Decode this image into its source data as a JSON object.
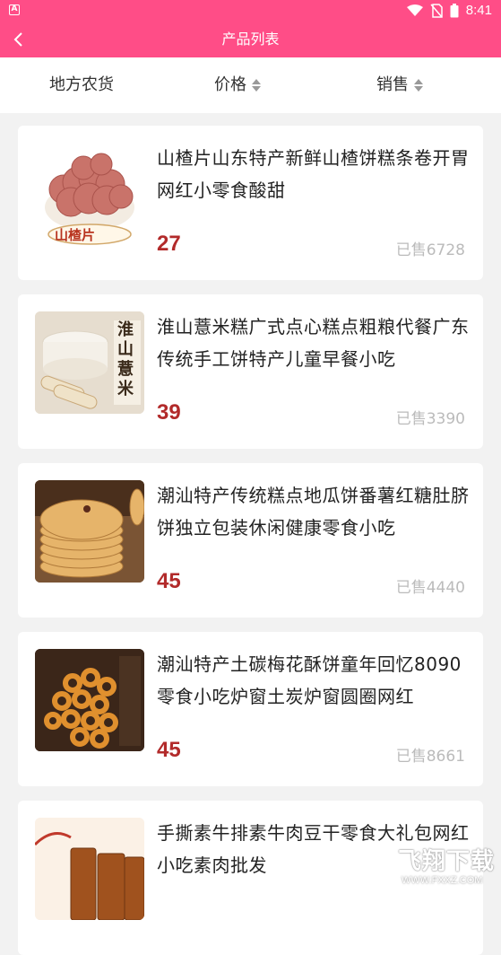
{
  "status_bar": {
    "time": "8:41"
  },
  "app_bar": {
    "title": "产品列表"
  },
  "filters": [
    {
      "label": "地方农货"
    },
    {
      "label": "价格"
    },
    {
      "label": "销售"
    }
  ],
  "products": [
    {
      "name": "山楂片山东特产新鲜山楂饼糕条卷开胃网红小零食酸甜",
      "price": "27",
      "sold": "已售6728",
      "thumb_label": "山楂片"
    },
    {
      "name": "淮山薏米糕广式点心糕点粗粮代餐广东传统手工饼特产儿童早餐小吃",
      "price": "39",
      "sold": "已售3390",
      "thumb_label": "淮山薏米"
    },
    {
      "name": "潮汕特产传统糕点地瓜饼番薯红糖肚脐饼独立包装休闲健康零食小吃",
      "price": "45",
      "sold": "已售4440"
    },
    {
      "name": "潮汕特产土碳梅花酥饼童年回忆8090零食小吃炉窗土炭炉窗圆圈网红",
      "price": "45",
      "sold": "已售8661"
    },
    {
      "name": "手撕素牛排素牛肉豆干零食大礼包网红小吃素肉批发",
      "price": "",
      "sold": ""
    }
  ],
  "watermark": {
    "text": "飞翔下载",
    "url": "WWW.FXXZ.COM"
  },
  "colors": {
    "brand": "#ff4d87",
    "price": "#b22a2a"
  }
}
